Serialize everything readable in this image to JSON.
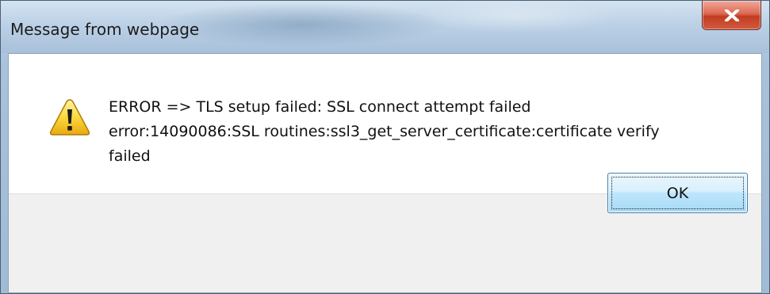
{
  "dialog": {
    "title": "Message from webpage",
    "close_icon": "close-icon",
    "icon": "warning-icon",
    "message_lines": [
      "ERROR => TLS setup failed: SSL connect attempt failed",
      "error:14090086:SSL routines:ssl3_get_server_certificate:certificate verify",
      "failed"
    ],
    "ok_label": "OK"
  },
  "colors": {
    "close_button": "#c94a30",
    "ok_button_border": "#3c7fb1",
    "warning_fill": "#f8d23a"
  }
}
